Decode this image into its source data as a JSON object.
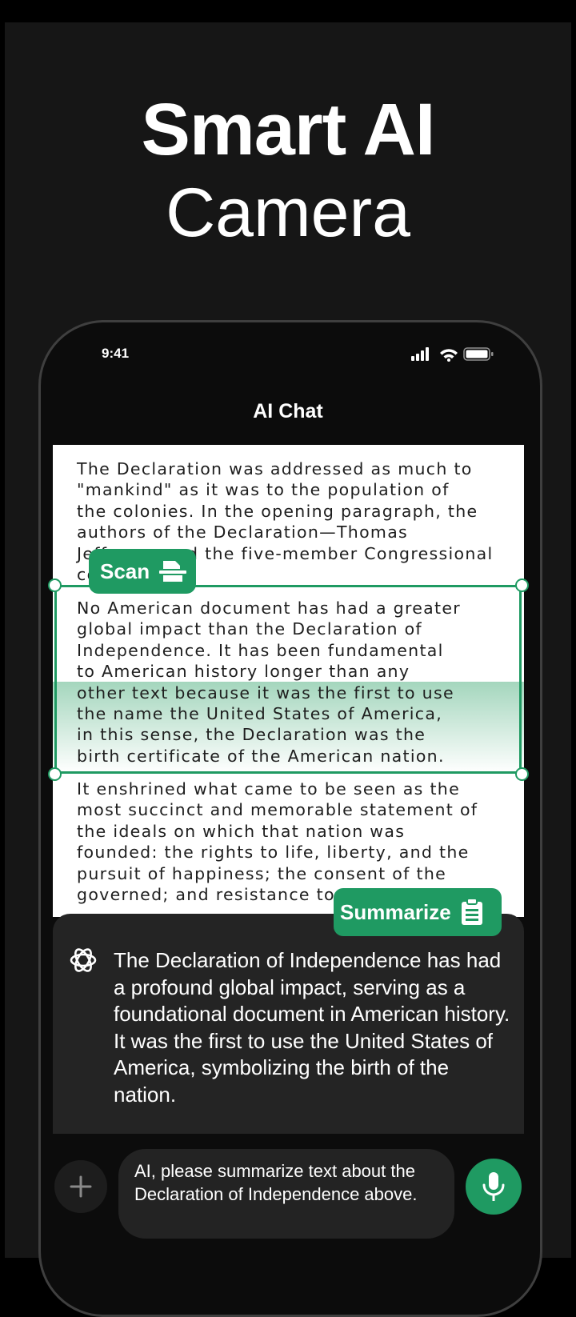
{
  "promo": {
    "headline_line1": "Smart AI",
    "headline_line2": "Camera"
  },
  "status_bar": {
    "time": "9:41",
    "icons": [
      "cellular-signal-icon",
      "wifi-icon",
      "battery-icon"
    ]
  },
  "chat": {
    "title": "AI Chat"
  },
  "document": {
    "paragraph_1": "The Declaration was addressed as much to\n\"mankind\" as it was to the population of\nthe colonies. In the opening paragraph, the\nauthors of the Declaration—Thomas\nJefferson and the five-member Congressional\ncommittee",
    "paragraph_2": "No American document has had a greater\nglobal impact than the Declaration of\nIndependence. It has been fundamental\nto American history longer than any\nother text because it was the first to use\nthe name the United States of America,\nin this sense, the Declaration was the\nbirth certificate of the American nation.",
    "paragraph_3": "It enshrined what came to be seen as the\nmost succinct and memorable statement of\nthe ideals on which that nation was\nfounded: the rights to life, liberty, and the\npursuit of happiness; the consent of the\ngoverned; and resistance to tyranny"
  },
  "actions": {
    "scan_label": "Scan",
    "summarize_label": "Summarize"
  },
  "ai_response": {
    "text": "The Declaration of Independence has had a profound global impact, serving as a foundational document in American history. It was the first to use the United States of America, symbolizing the birth of the nation."
  },
  "input": {
    "text": "AI, please summarize text about the Declaration of Independence above."
  },
  "colors": {
    "accent": "#1f9a62",
    "background": "#161616",
    "bubble": "#242424"
  }
}
